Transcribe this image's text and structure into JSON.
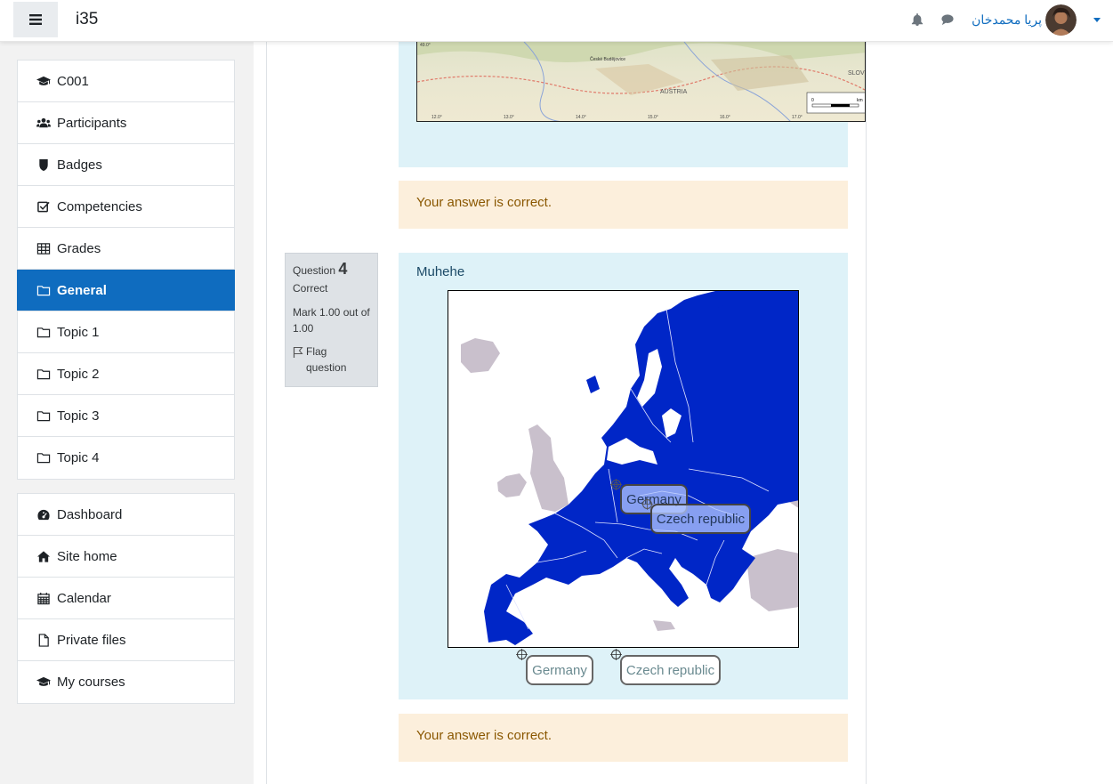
{
  "navbar": {
    "site_name": "i35",
    "user_name": "پریا محمدخان",
    "icons": [
      "menu-icon",
      "bell-icon",
      "comment-icon"
    ]
  },
  "drawer": {
    "course_nav": [
      {
        "label": "C001",
        "icon": "graduation-cap-icon"
      },
      {
        "label": "Participants",
        "icon": "users-icon"
      },
      {
        "label": "Badges",
        "icon": "shield-icon"
      },
      {
        "label": "Competencies",
        "icon": "check-square-icon"
      },
      {
        "label": "Grades",
        "icon": "table-icon"
      },
      {
        "label": "General",
        "icon": "folder-icon",
        "active": true
      },
      {
        "label": "Topic 1",
        "icon": "folder-icon"
      },
      {
        "label": "Topic 2",
        "icon": "folder-icon"
      },
      {
        "label": "Topic 3",
        "icon": "folder-icon"
      },
      {
        "label": "Topic 4",
        "icon": "folder-icon"
      }
    ],
    "site_nav": [
      {
        "label": "Dashboard",
        "icon": "dashboard-icon"
      },
      {
        "label": "Site home",
        "icon": "home-icon"
      },
      {
        "label": "Calendar",
        "icon": "calendar-icon"
      },
      {
        "label": "Private files",
        "icon": "file-icon"
      },
      {
        "label": "My courses",
        "icon": "graduation-cap-icon"
      }
    ]
  },
  "previous_question": {
    "map_labels": [
      "České Budějovice",
      "AUSTRIA",
      "SLOV",
      "0",
      "km",
      "12.0°",
      "13.0°",
      "14.0°",
      "15.0°",
      "16.0°",
      "17.0°",
      "49.0°"
    ],
    "feedback": "Your answer is correct."
  },
  "question": {
    "label": "Question",
    "number": "4",
    "state": "Correct",
    "mark": "Mark 1.00 out of 1.00",
    "flag": "Flag question",
    "text": "Muhehe",
    "placed_items": [
      "Germany",
      "Czech republic"
    ],
    "draggable_items": [
      "Germany",
      "Czech republic"
    ],
    "feedback": "Your answer is correct."
  },
  "colors": {
    "accent": "#0f6cbf",
    "eu_fill": "#0026c7",
    "non_eu": "#c9c0cc",
    "question_bg": "#def2f8",
    "feedback_bg": "#fcefdc"
  }
}
